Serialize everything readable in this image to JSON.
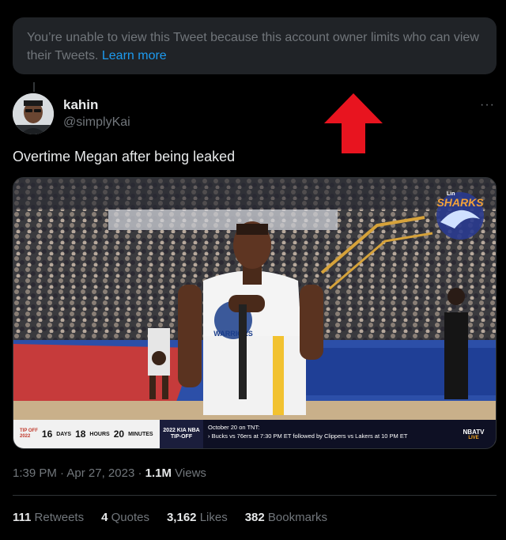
{
  "notice": {
    "text": "You’re unable to view this Tweet because this account owner limits who can view their Tweets.",
    "link": "Learn more"
  },
  "author": {
    "name": "kahin",
    "handle": "@simplyKai"
  },
  "more_label": "···",
  "tweet": {
    "text": "Overtime Megan after being leaked"
  },
  "media": {
    "watermark_text": "SHARKS",
    "watermark_small": "Lin",
    "jersey_text": "WARRIORS",
    "scorebar": {
      "event_line1": "TIP OFF",
      "event_year": "2022",
      "days_value": "16",
      "days_unit": "DAYS",
      "hours_value": "18",
      "hours_unit": "HOURS",
      "minutes_value": "20",
      "minutes_unit": "MINUTES",
      "tip_line1": "2022 KIA NBA",
      "tip_line2": "TIP-OFF",
      "info_line1": "October 20 on TNT:",
      "info_line2": "› Bucks vs 76ers at 7:30 PM ET followed by Clippers vs Lakers at 10 PM ET",
      "network": "NBATV",
      "live": "LIVE"
    }
  },
  "meta": {
    "time": "1:39 PM",
    "date": "Apr 27, 2023",
    "views_value": "1.1M",
    "views_label": "Views"
  },
  "stats": {
    "retweets_value": "111",
    "retweets_label": "Retweets",
    "quotes_value": "4",
    "quotes_label": "Quotes",
    "likes_value": "3,162",
    "likes_label": "Likes",
    "bookmarks_value": "382",
    "bookmarks_label": "Bookmarks"
  },
  "colors": {
    "background": "#000000",
    "notice_bg": "#202327",
    "link": "#1d9bf0",
    "muted": "#71767b",
    "arrow": "#e8141f"
  }
}
